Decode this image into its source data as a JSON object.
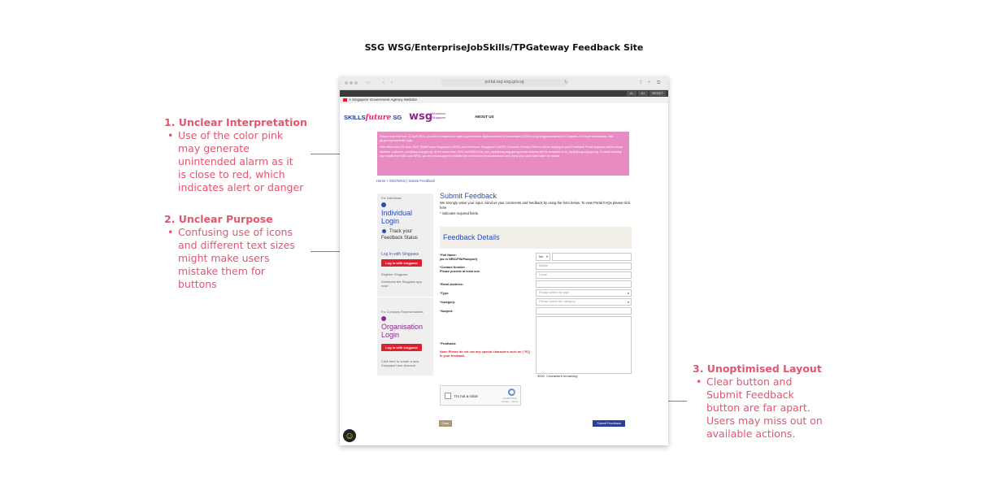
{
  "heading": "SSG WSG/EnterpriseJobSkills/TPGateway Feedback Site",
  "annotations": [
    {
      "title": "1. Unclear Interpretation",
      "lines": [
        "Use of the color pink",
        "may generate",
        "unintended alarm as it",
        "is close to red, which",
        "indicates alert or danger"
      ]
    },
    {
      "title": "2. Unclear Purpose",
      "lines": [
        "Confusing use of icons",
        "and different text sizes",
        "might make users",
        "mistake them for",
        "buttons"
      ]
    },
    {
      "title": "3. Unoptimised Layout",
      "lines": [
        "Clear button and",
        "Submit Feedback",
        "button are far apart.",
        "Users may miss out on",
        "available actions."
      ]
    }
  ],
  "browser": {
    "url": "portal.ssg-wsg.gov.sg",
    "toolbar": {
      "zoom_out": "A-",
      "zoom_in": "A+",
      "reset": "RESET"
    },
    "gov_banner": "A Singapore Government Agency Website",
    "logo_skills": "SKILLS",
    "logo_future": "future",
    "logo_sg": "SG",
    "logo_wsg": "wsg",
    "logo_wsg_sub": "Workforce Singapore",
    "nav_about": "ABOUT US",
    "notice_p1": "Please note that from 11 April 2021, you will be required to login to government digital services for businesses (GDS) using Singpass instead of Corppass. For more information, visit go.gov.sg/corporate-login.",
    "notice_p2": "With effect from 24 June 2022, SkillsFuture Singapore's (SSG) and Workforce Singapore's (WSG) Customer Service Officers will be replying to your Feedback Portal enquiries via the email address, customer_svc@ssg-wsg.gov.sg. At the same time, SSG and WSG's do_not_reply@ssg-wsg.gov.sg email address will be renamed to no_reply@ssg-wsg.gov.sg. To avoid missing any emails from SSG and WSG, you are encouraged to whitelist the mentioned email addresses and check your Junk Mail folder for emails.",
    "breadcrumb": "Home > SSG/WSG | Submit Feedback",
    "sidebar": {
      "for_individuals": "For Individuals",
      "individual_login": "Individual Login",
      "track_status": "Track your Feedback Status",
      "login_singpass_link": "Log In with Singpass",
      "login_singpass_btn": "Log in with singpass",
      "register": "Register Singpass",
      "download": "Download the Singpass app now!",
      "for_company": "For Company Representatives",
      "organisation_login": "Organisation Login",
      "org_btn": "Log in with singpass",
      "create_account": "Click here to create a new Corppass User Account"
    },
    "form": {
      "title": "Submit Feedback",
      "intro": "We strongly value your input. Send us your comments and feedback by using the form below. To view Portal FAQs please click here",
      "required_note": "* indicates required fields.",
      "section_title": "Feedback Details",
      "full_name_label": "*Full Name:",
      "full_name_sub": "(as in NRIC/FIN/Passport)",
      "salutation": "Ms",
      "contact_label": "*Contact Number",
      "contact_sub": "Please provide at least one.",
      "mobile_placeholder": "Mobile",
      "home_placeholder": "Home",
      "email_label": "*Email Address:",
      "type_label": "*Type:",
      "type_placeholder": "Please select the type",
      "category_label": "*Category:",
      "category_placeholder": "Please select the category",
      "subject_label": "*Subject:",
      "feedback_label": "*Feedback:",
      "feedback_note": "Note: Please do not use any special characters such as \\,^$'|] in your feedback.",
      "char_count": "3000",
      "char_remaining": "Characters remaining",
      "captcha_label": "I'm not a robot",
      "captcha_sub": "reCAPTCHA Privacy - Terms",
      "clear_btn": "Clear",
      "submit_btn": "Submit Feedback"
    }
  }
}
